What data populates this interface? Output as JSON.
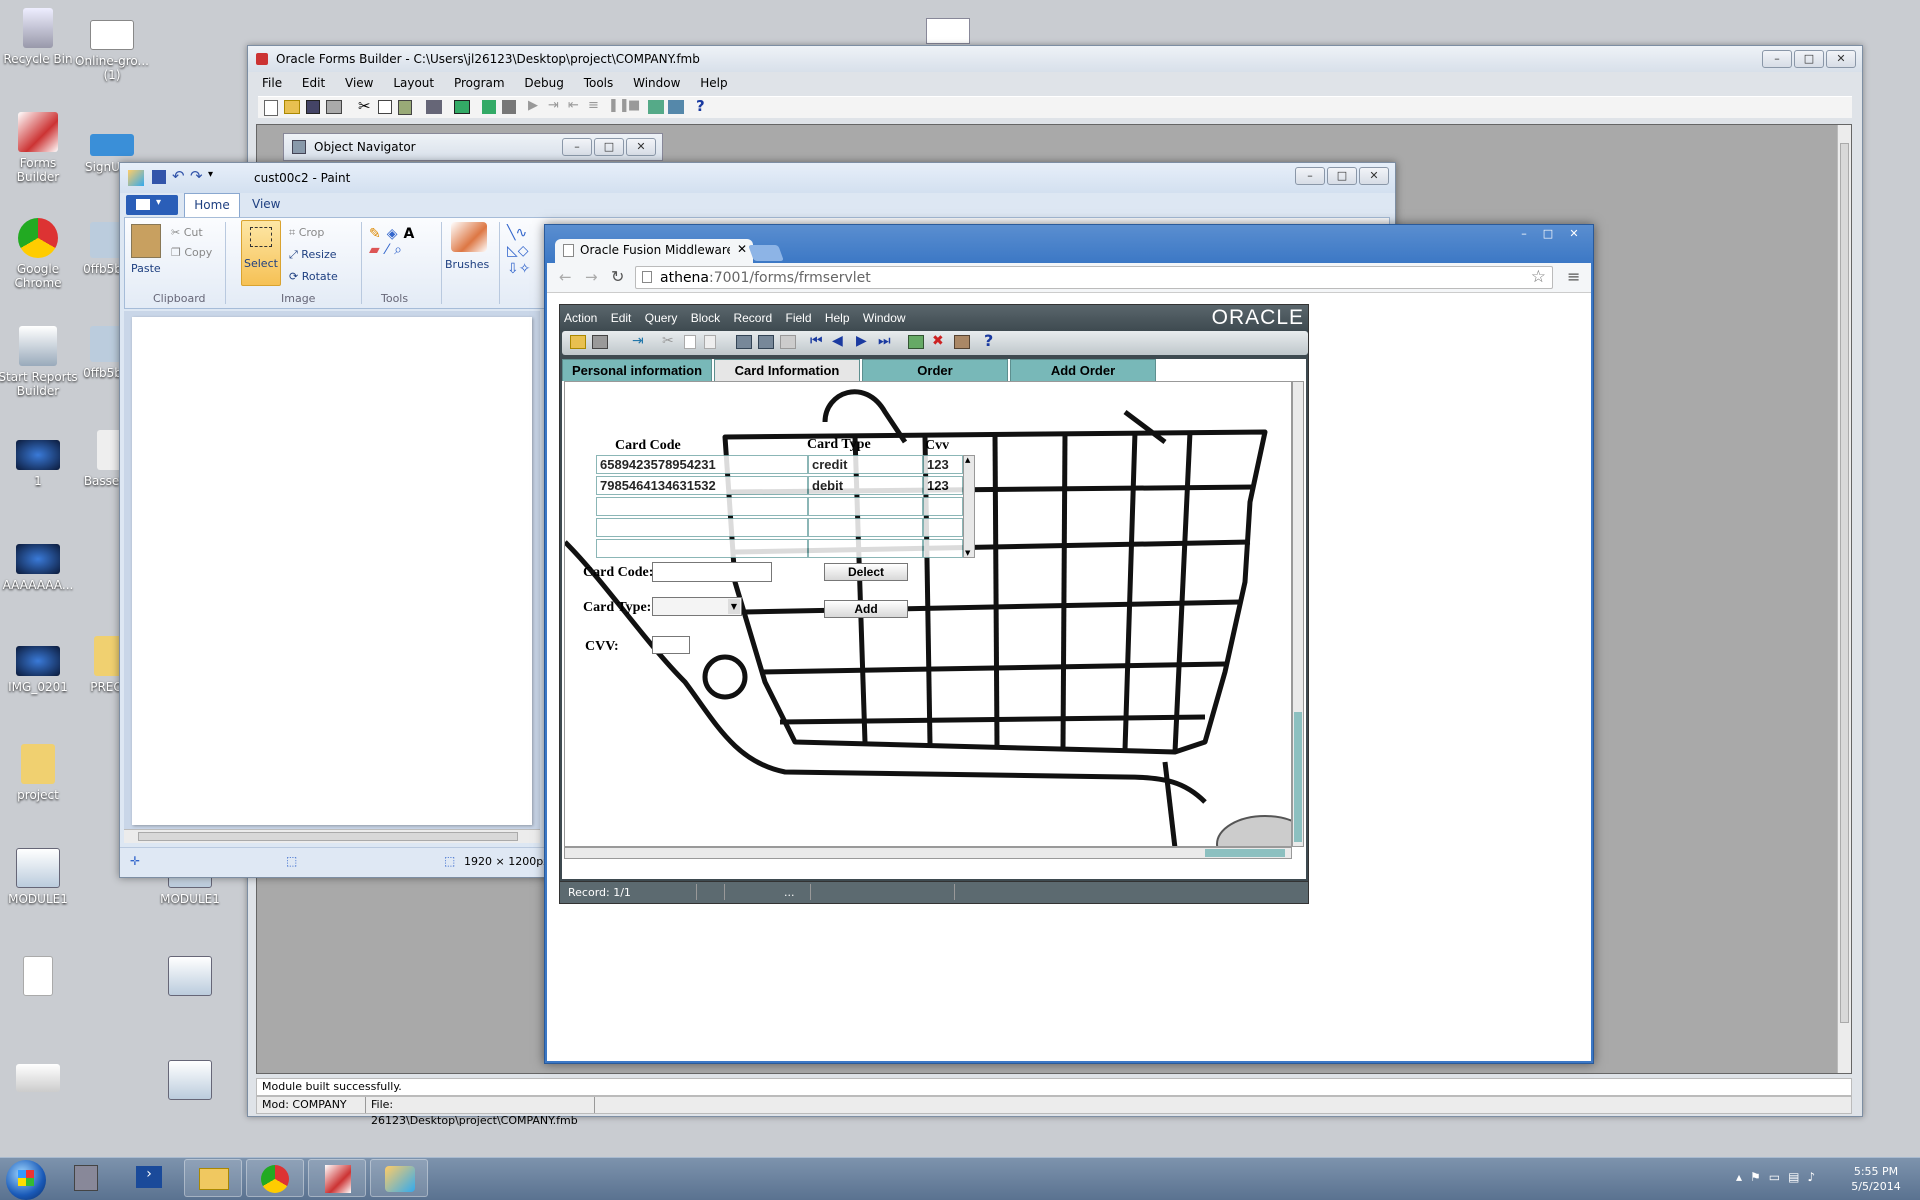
{
  "desktop": {
    "icons": [
      {
        "label": "Recycle Bin"
      },
      {
        "label": "Online-gro...\n(1)"
      },
      {
        "label": "Forms\nBuilder"
      },
      {
        "label": "SignUp..."
      },
      {
        "label": "Google\nChrome"
      },
      {
        "label": "0ffb5b6..."
      },
      {
        "label": "Start Reports\nBuilder"
      },
      {
        "label": "0ffb5b6..."
      },
      {
        "label": "1"
      },
      {
        "label": "Bassett..."
      },
      {
        "label": "AAAAAAA..."
      },
      {
        "label": "IMG_0201"
      },
      {
        "label": "PREO..."
      },
      {
        "label": "project"
      },
      {
        "label": "MODULE1"
      },
      {
        "label": "MODULE1"
      }
    ]
  },
  "forms_builder": {
    "title": "Oracle Forms Builder - C:\\Users\\jl26123\\Desktop\\project\\COMPANY.fmb",
    "menu": [
      "File",
      "Edit",
      "View",
      "Layout",
      "Program",
      "Debug",
      "Tools",
      "Window",
      "Help"
    ],
    "help_glyph": "?",
    "object_navigator_title": "Object Navigator",
    "status_message": "Module built successfully.",
    "status_module": "Mod: COMPANY",
    "status_file": "File: 26123\\Desktop\\project\\COMPANY.fmb"
  },
  "paint": {
    "title": "cust00c2 - Paint",
    "tabs": [
      "Home",
      "View"
    ],
    "groups": {
      "clipboard": "Clipboard",
      "image": "Image",
      "tools": "Tools"
    },
    "buttons": {
      "paste": "Paste",
      "cut": "Cut",
      "copy": "Copy",
      "select": "Select",
      "crop": "Crop",
      "resize": "Resize",
      "rotate": "Rotate",
      "brushes": "Brushes"
    },
    "dimensions": "1920 × 1200px"
  },
  "chrome": {
    "tab_title": "Oracle Fusion Middleware",
    "url_host": "athena",
    "url_rest": ":7001/forms/frmservlet"
  },
  "oracle_form": {
    "menu": [
      "Action",
      "Edit",
      "Query",
      "Block",
      "Record",
      "Field",
      "Help",
      "Window"
    ],
    "brand": "ORACLE",
    "help_glyph": "?",
    "tabs": [
      "Personal information",
      "Card Information",
      "Order",
      "Add Order"
    ],
    "active_tab": "Card Information",
    "table": {
      "headers": [
        "Card Code",
        "Card Type",
        "Cvv"
      ],
      "rows": [
        [
          "6589423578954231",
          "credit",
          "123"
        ],
        [
          "7985464134631532",
          "debit",
          "123"
        ],
        [
          "",
          "",
          ""
        ],
        [
          "",
          "",
          ""
        ],
        [
          "",
          "",
          ""
        ]
      ]
    },
    "fields": {
      "card_code_label": "Card Code:",
      "card_type_label": "Card Type:",
      "cvv_label": "CVV:"
    },
    "buttons": {
      "delete": "Delect",
      "add": "Add"
    },
    "status": "Record: 1/1",
    "status_ellipsis": "..."
  },
  "taskbar": {
    "time": "5:55 PM",
    "date": "5/5/2014"
  }
}
